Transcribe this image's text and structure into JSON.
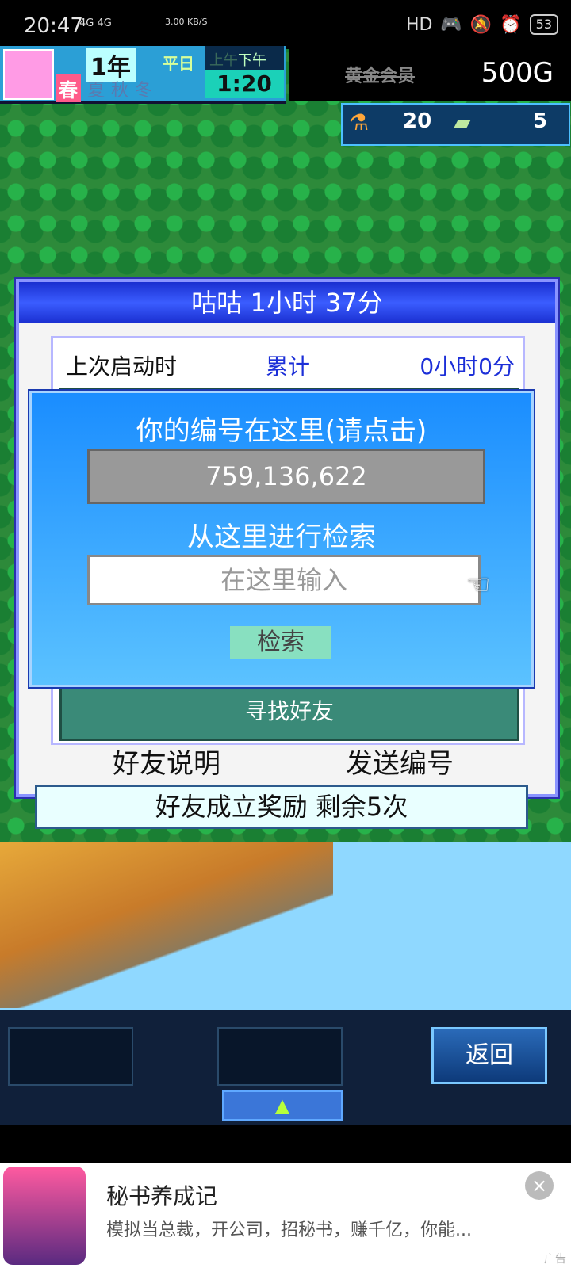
{
  "status": {
    "time": "20:47",
    "network": "4G 4G",
    "speed": "3.00 KB/S",
    "right_icons": "HD",
    "battery": "53"
  },
  "hud": {
    "year": "1年",
    "weekday": "平日",
    "season_current": "春",
    "seasons_other": "夏秋冬",
    "am": "上午",
    "pm": "下午",
    "clock": "1:20",
    "member": "黄金会员",
    "gold": "500G",
    "resource1": "20",
    "resource2": "5"
  },
  "dialog": {
    "title": "咕咕  1小时 37分",
    "last_launch": "上次启动时",
    "total": "累计",
    "total_value": "0小时0分",
    "find_friends": "寻找好友",
    "footer_left": "好友说明",
    "footer_right": "发送编号"
  },
  "popup": {
    "id_prompt": "你的编号在这里(请点击)",
    "id_value": "759,136,622",
    "search_prompt": "从这里进行检索",
    "input_placeholder": "在这里输入",
    "search_button": "检索"
  },
  "reward": {
    "text": "好友成立奖励  剩余5次"
  },
  "controls": {
    "back": "返回",
    "up_icon": "triangle-up-icon"
  },
  "ad": {
    "title": "秘书养成记",
    "description": "模拟当总裁，开公司，招秘书，赚千亿，你能...",
    "close": "×",
    "label": "广告"
  }
}
